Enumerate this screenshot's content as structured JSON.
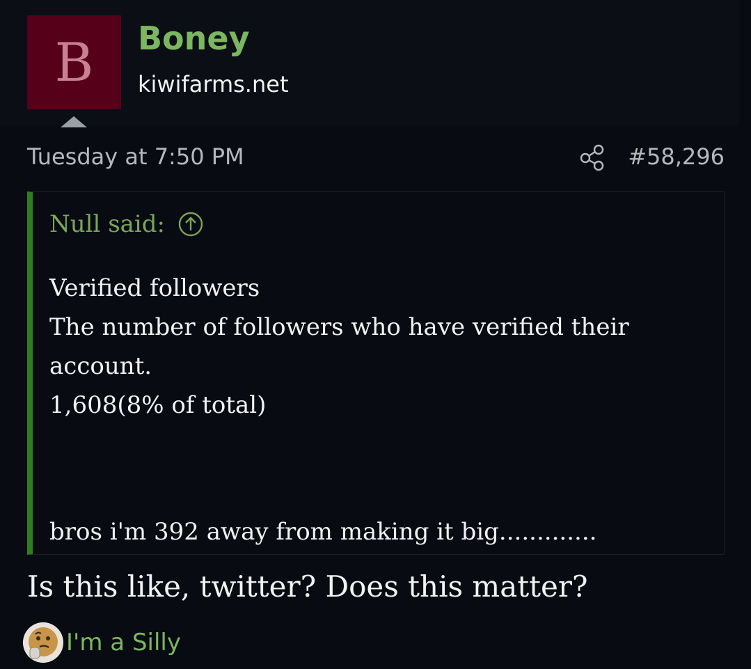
{
  "post": {
    "avatar_letter": "B",
    "username": "Boney",
    "site": "kiwifarms.net",
    "timestamp": "Tuesday at 7:50 PM",
    "post_number": "#58,296",
    "share_icon": "share-icon"
  },
  "quote": {
    "attribution": "Null said:",
    "jump_icon": "arrow-up-circle-icon",
    "lines": [
      "Verified followers",
      "The number of followers who have verified their",
      "account.",
      "1,608(8% of total)"
    ],
    "last_line": "bros i'm 392 away from making it big.............",
    "accent_color": "#2e7d1f"
  },
  "reply": {
    "text": "Is this like, twitter? Does this matter?"
  },
  "reaction": {
    "icon": "thinking-face-icon",
    "label": "I'm a Silly"
  },
  "colors": {
    "background": "#080b12",
    "username": "#7bb661",
    "avatar_bg": "#56001a"
  }
}
